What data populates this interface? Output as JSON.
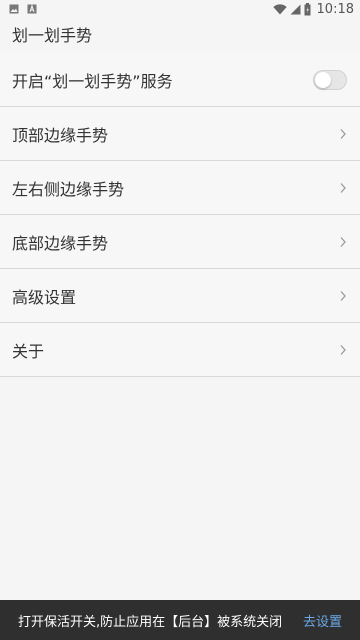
{
  "status_bar": {
    "time": "10:18",
    "icons": [
      "image-icon",
      "text-icon",
      "wifi-icon",
      "signal-icon",
      "battery-icon"
    ]
  },
  "app": {
    "title": "划一划手势"
  },
  "settings": {
    "service_toggle": {
      "label": "开启“划一划手势”服务",
      "enabled": false
    },
    "items": [
      {
        "label": "顶部边缘手势"
      },
      {
        "label": "左右侧边缘手势"
      },
      {
        "label": "底部边缘手势"
      },
      {
        "label": "高级设置"
      },
      {
        "label": "关于"
      }
    ]
  },
  "snackbar": {
    "message": "打开保活开关,防止应用在【后台】被系统关闭",
    "action": "去设置"
  },
  "colors": {
    "background": "#f5f5f5",
    "snackbar_bg": "#2f2f2f",
    "snackbar_action": "#6aa8e8",
    "divider": "#d9d9d9"
  }
}
